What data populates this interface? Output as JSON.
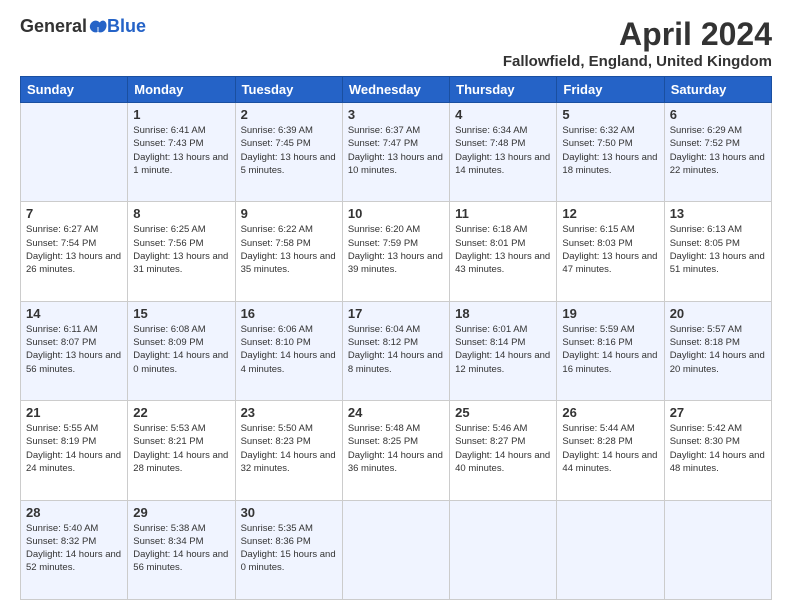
{
  "header": {
    "logo_general": "General",
    "logo_blue": "Blue",
    "month_title": "April 2024",
    "location": "Fallowfield, England, United Kingdom"
  },
  "days_of_week": [
    "Sunday",
    "Monday",
    "Tuesday",
    "Wednesday",
    "Thursday",
    "Friday",
    "Saturday"
  ],
  "weeks": [
    [
      {
        "day": "",
        "sunrise": "",
        "sunset": "",
        "daylight": ""
      },
      {
        "day": "1",
        "sunrise": "Sunrise: 6:41 AM",
        "sunset": "Sunset: 7:43 PM",
        "daylight": "Daylight: 13 hours and 1 minute."
      },
      {
        "day": "2",
        "sunrise": "Sunrise: 6:39 AM",
        "sunset": "Sunset: 7:45 PM",
        "daylight": "Daylight: 13 hours and 5 minutes."
      },
      {
        "day": "3",
        "sunrise": "Sunrise: 6:37 AM",
        "sunset": "Sunset: 7:47 PM",
        "daylight": "Daylight: 13 hours and 10 minutes."
      },
      {
        "day": "4",
        "sunrise": "Sunrise: 6:34 AM",
        "sunset": "Sunset: 7:48 PM",
        "daylight": "Daylight: 13 hours and 14 minutes."
      },
      {
        "day": "5",
        "sunrise": "Sunrise: 6:32 AM",
        "sunset": "Sunset: 7:50 PM",
        "daylight": "Daylight: 13 hours and 18 minutes."
      },
      {
        "day": "6",
        "sunrise": "Sunrise: 6:29 AM",
        "sunset": "Sunset: 7:52 PM",
        "daylight": "Daylight: 13 hours and 22 minutes."
      }
    ],
    [
      {
        "day": "7",
        "sunrise": "Sunrise: 6:27 AM",
        "sunset": "Sunset: 7:54 PM",
        "daylight": "Daylight: 13 hours and 26 minutes."
      },
      {
        "day": "8",
        "sunrise": "Sunrise: 6:25 AM",
        "sunset": "Sunset: 7:56 PM",
        "daylight": "Daylight: 13 hours and 31 minutes."
      },
      {
        "day": "9",
        "sunrise": "Sunrise: 6:22 AM",
        "sunset": "Sunset: 7:58 PM",
        "daylight": "Daylight: 13 hours and 35 minutes."
      },
      {
        "day": "10",
        "sunrise": "Sunrise: 6:20 AM",
        "sunset": "Sunset: 7:59 PM",
        "daylight": "Daylight: 13 hours and 39 minutes."
      },
      {
        "day": "11",
        "sunrise": "Sunrise: 6:18 AM",
        "sunset": "Sunset: 8:01 PM",
        "daylight": "Daylight: 13 hours and 43 minutes."
      },
      {
        "day": "12",
        "sunrise": "Sunrise: 6:15 AM",
        "sunset": "Sunset: 8:03 PM",
        "daylight": "Daylight: 13 hours and 47 minutes."
      },
      {
        "day": "13",
        "sunrise": "Sunrise: 6:13 AM",
        "sunset": "Sunset: 8:05 PM",
        "daylight": "Daylight: 13 hours and 51 minutes."
      }
    ],
    [
      {
        "day": "14",
        "sunrise": "Sunrise: 6:11 AM",
        "sunset": "Sunset: 8:07 PM",
        "daylight": "Daylight: 13 hours and 56 minutes."
      },
      {
        "day": "15",
        "sunrise": "Sunrise: 6:08 AM",
        "sunset": "Sunset: 8:09 PM",
        "daylight": "Daylight: 14 hours and 0 minutes."
      },
      {
        "day": "16",
        "sunrise": "Sunrise: 6:06 AM",
        "sunset": "Sunset: 8:10 PM",
        "daylight": "Daylight: 14 hours and 4 minutes."
      },
      {
        "day": "17",
        "sunrise": "Sunrise: 6:04 AM",
        "sunset": "Sunset: 8:12 PM",
        "daylight": "Daylight: 14 hours and 8 minutes."
      },
      {
        "day": "18",
        "sunrise": "Sunrise: 6:01 AM",
        "sunset": "Sunset: 8:14 PM",
        "daylight": "Daylight: 14 hours and 12 minutes."
      },
      {
        "day": "19",
        "sunrise": "Sunrise: 5:59 AM",
        "sunset": "Sunset: 8:16 PM",
        "daylight": "Daylight: 14 hours and 16 minutes."
      },
      {
        "day": "20",
        "sunrise": "Sunrise: 5:57 AM",
        "sunset": "Sunset: 8:18 PM",
        "daylight": "Daylight: 14 hours and 20 minutes."
      }
    ],
    [
      {
        "day": "21",
        "sunrise": "Sunrise: 5:55 AM",
        "sunset": "Sunset: 8:19 PM",
        "daylight": "Daylight: 14 hours and 24 minutes."
      },
      {
        "day": "22",
        "sunrise": "Sunrise: 5:53 AM",
        "sunset": "Sunset: 8:21 PM",
        "daylight": "Daylight: 14 hours and 28 minutes."
      },
      {
        "day": "23",
        "sunrise": "Sunrise: 5:50 AM",
        "sunset": "Sunset: 8:23 PM",
        "daylight": "Daylight: 14 hours and 32 minutes."
      },
      {
        "day": "24",
        "sunrise": "Sunrise: 5:48 AM",
        "sunset": "Sunset: 8:25 PM",
        "daylight": "Daylight: 14 hours and 36 minutes."
      },
      {
        "day": "25",
        "sunrise": "Sunrise: 5:46 AM",
        "sunset": "Sunset: 8:27 PM",
        "daylight": "Daylight: 14 hours and 40 minutes."
      },
      {
        "day": "26",
        "sunrise": "Sunrise: 5:44 AM",
        "sunset": "Sunset: 8:28 PM",
        "daylight": "Daylight: 14 hours and 44 minutes."
      },
      {
        "day": "27",
        "sunrise": "Sunrise: 5:42 AM",
        "sunset": "Sunset: 8:30 PM",
        "daylight": "Daylight: 14 hours and 48 minutes."
      }
    ],
    [
      {
        "day": "28",
        "sunrise": "Sunrise: 5:40 AM",
        "sunset": "Sunset: 8:32 PM",
        "daylight": "Daylight: 14 hours and 52 minutes."
      },
      {
        "day": "29",
        "sunrise": "Sunrise: 5:38 AM",
        "sunset": "Sunset: 8:34 PM",
        "daylight": "Daylight: 14 hours and 56 minutes."
      },
      {
        "day": "30",
        "sunrise": "Sunrise: 5:35 AM",
        "sunset": "Sunset: 8:36 PM",
        "daylight": "Daylight: 15 hours and 0 minutes."
      },
      {
        "day": "",
        "sunrise": "",
        "sunset": "",
        "daylight": ""
      },
      {
        "day": "",
        "sunrise": "",
        "sunset": "",
        "daylight": ""
      },
      {
        "day": "",
        "sunrise": "",
        "sunset": "",
        "daylight": ""
      },
      {
        "day": "",
        "sunrise": "",
        "sunset": "",
        "daylight": ""
      }
    ]
  ]
}
